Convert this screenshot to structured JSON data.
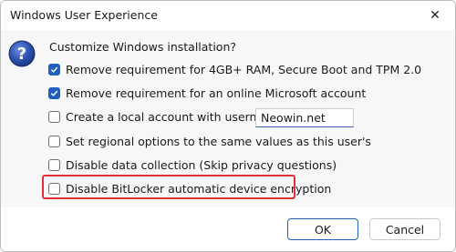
{
  "window": {
    "title": "Windows User Experience",
    "close_glyph": "✕"
  },
  "dialog": {
    "icon": "question-icon",
    "heading": "Customize Windows installation?",
    "options": [
      {
        "label": "Remove requirement for 4GB+ RAM, Secure Boot and TPM 2.0",
        "checked": true
      },
      {
        "label": "Remove requirement for an online Microsoft account",
        "checked": true
      },
      {
        "label": "Create a local account with username:",
        "checked": false
      },
      {
        "label": "Set regional options to the same values as this user's",
        "checked": false
      },
      {
        "label": "Disable data collection (Skip privacy questions)",
        "checked": false
      },
      {
        "label": "Disable BitLocker automatic device encryption",
        "checked": false
      }
    ],
    "username_value": "Neowin.net"
  },
  "buttons": {
    "ok": "OK",
    "cancel": "Cancel"
  },
  "colors": {
    "accent": "#1f5fbf",
    "highlight": "#e0313b"
  }
}
